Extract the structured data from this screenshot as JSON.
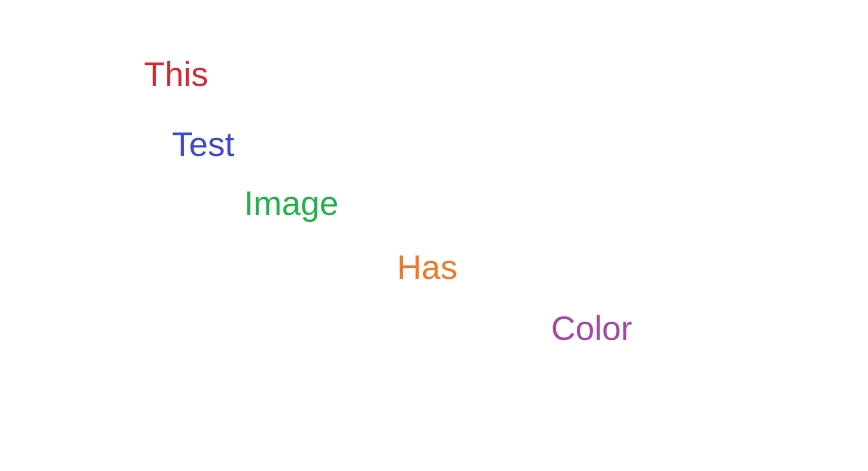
{
  "words": [
    {
      "text": "This",
      "color": "#d42a2f"
    },
    {
      "text": "Test",
      "color": "#3f48cc"
    },
    {
      "text": "Image",
      "color": "#22b14c"
    },
    {
      "text": "Has",
      "color": "#f0782a"
    },
    {
      "text": "Color",
      "color": "#a349a4"
    }
  ]
}
